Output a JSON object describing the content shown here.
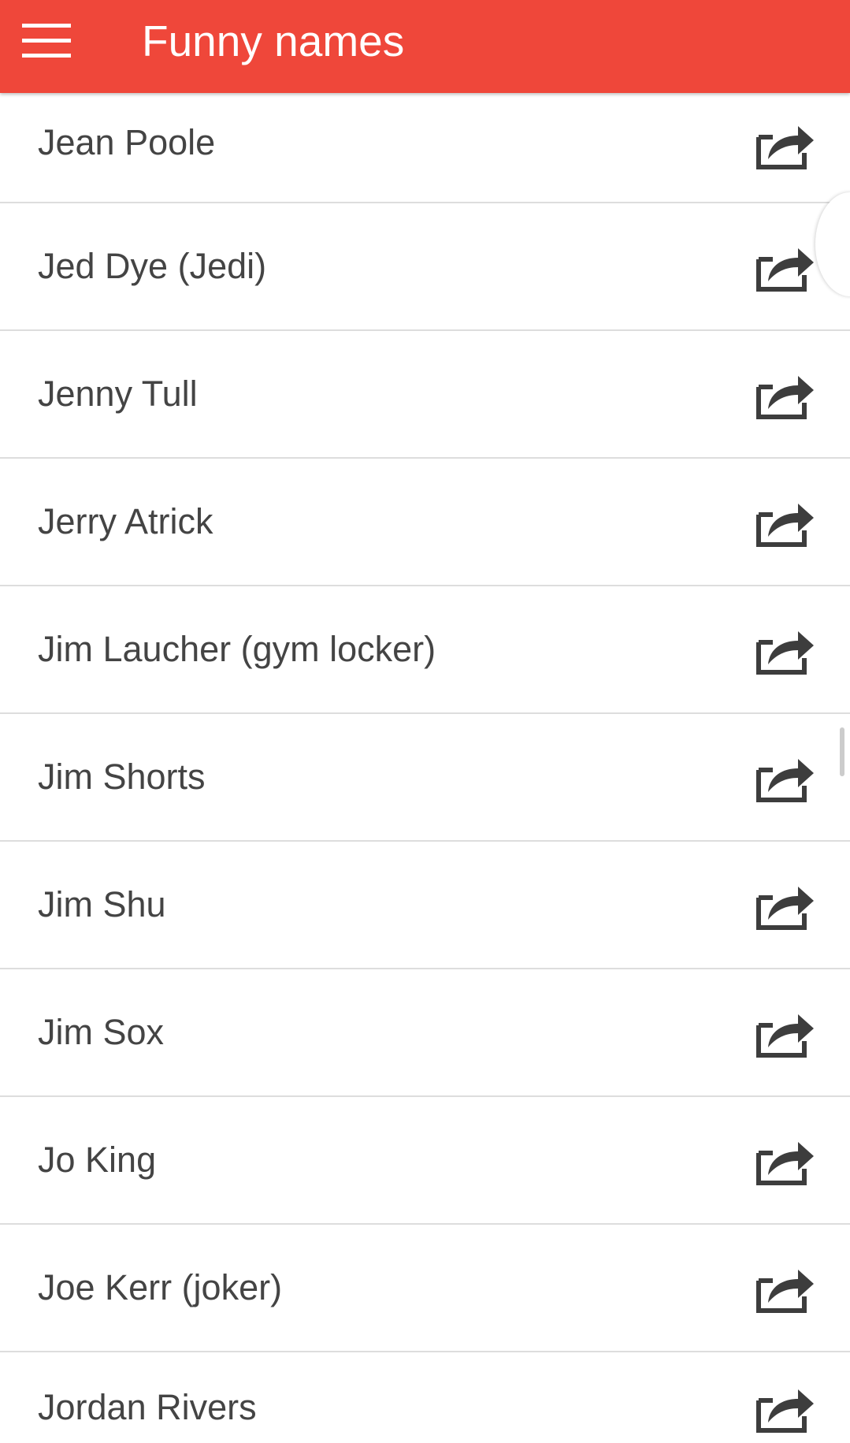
{
  "app_bar": {
    "title": "Funny names",
    "menu_icon": "hamburger-menu-icon",
    "color": "#ef473a"
  },
  "list": {
    "share_icon": "share-icon",
    "items": [
      {
        "label": "Jean Poole"
      },
      {
        "label": "Jed Dye (Jedi)"
      },
      {
        "label": "Jenny Tull"
      },
      {
        "label": "Jerry Atrick"
      },
      {
        "label": "Jim Laucher (gym locker)"
      },
      {
        "label": "Jim Shorts"
      },
      {
        "label": "Jim Shu"
      },
      {
        "label": "Jim Sox"
      },
      {
        "label": "Jo King"
      },
      {
        "label": "Joe Kerr (joker)"
      },
      {
        "label": "Jordan Rivers"
      }
    ]
  }
}
